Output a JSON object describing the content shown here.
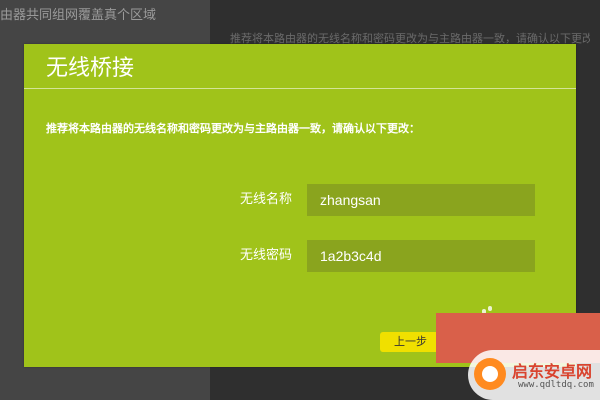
{
  "background": {
    "left_header": "由器共同组网覆盖真个区域",
    "right_text": "推荐将本路由器的无线名称和密码更改为与主路由器一致，请确认以下更改"
  },
  "dialog": {
    "title": "无线桥接",
    "description": "推荐将本路由器的无线名称和密码更改为与主路由器一致，请确认以下更改：",
    "fields": [
      {
        "label": "无线名称",
        "value": "zhangsan"
      },
      {
        "label": "无线密码",
        "value": "1a2b3c4d"
      }
    ],
    "prev_button": "上一步"
  },
  "watermark": {
    "title": "启东安卓网",
    "url": "www.qdltdq.com"
  },
  "colors": {
    "dialog_bg": "#a0c31a",
    "input_bg": "#8aa41e",
    "prev_button_bg": "#f0e000",
    "next_block_bg": "#d9604a"
  }
}
